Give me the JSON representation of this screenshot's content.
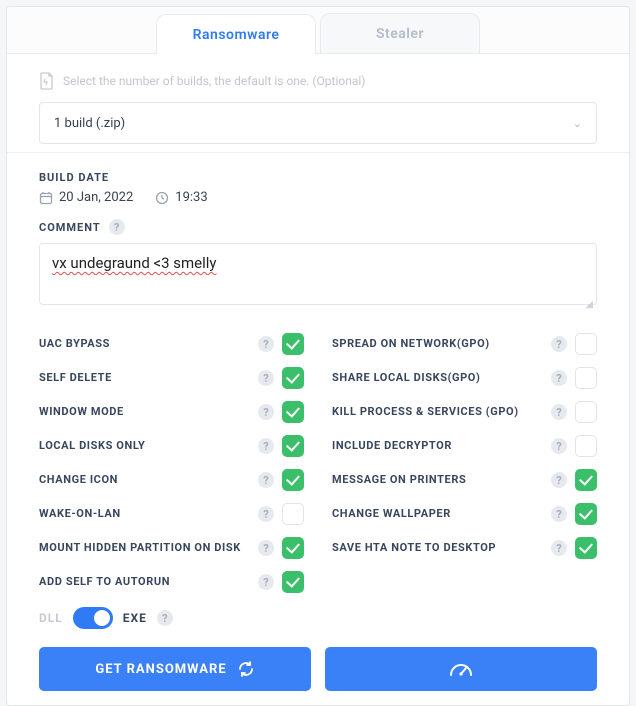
{
  "tabs": {
    "ransomware": "Ransomware",
    "stealer": "Stealer"
  },
  "builds": {
    "hint": "Select the number of builds, the default is one. (Optional)",
    "selected": "1 build (.zip)"
  },
  "build_date": {
    "label": "BUILD DATE",
    "date": "20 Jan, 2022",
    "time": "19:33"
  },
  "comment": {
    "label": "COMMENT",
    "value": "vx undegraund <3 smelly"
  },
  "options_left": [
    {
      "label": "UAC BYPASS",
      "checked": true
    },
    {
      "label": "SELF DELETE",
      "checked": true
    },
    {
      "label": "WINDOW MODE",
      "checked": true
    },
    {
      "label": "LOCAL DISKS ONLY",
      "checked": true
    },
    {
      "label": "CHANGE ICON",
      "checked": true
    },
    {
      "label": "WAKE-ON-LAN",
      "checked": false
    },
    {
      "label": "MOUNT HIDDEN PARTITION ON DISK",
      "checked": true
    },
    {
      "label": "ADD SELF TO AUTORUN",
      "checked": true
    }
  ],
  "options_right": [
    {
      "label": "SPREAD ON NETWORK(GPO)",
      "checked": false
    },
    {
      "label": "SHARE LOCAL DISKS(GPO)",
      "checked": false
    },
    {
      "label": "KILL PROCESS & SERVICES (GPO)",
      "checked": false
    },
    {
      "label": "INCLUDE DECRYPTOR",
      "checked": false
    },
    {
      "label": "MESSAGE ON PRINTERS",
      "checked": true
    },
    {
      "label": "CHANGE WALLPAPER",
      "checked": true
    },
    {
      "label": "SAVE HTA NOTE TO DESKTOP",
      "checked": true
    }
  ],
  "format": {
    "left": "DLL",
    "right": "EXE"
  },
  "actions": {
    "primary": "GET RANSOMWARE"
  },
  "colors": {
    "accent": "#3a80f6",
    "success": "#3bbf6a"
  }
}
